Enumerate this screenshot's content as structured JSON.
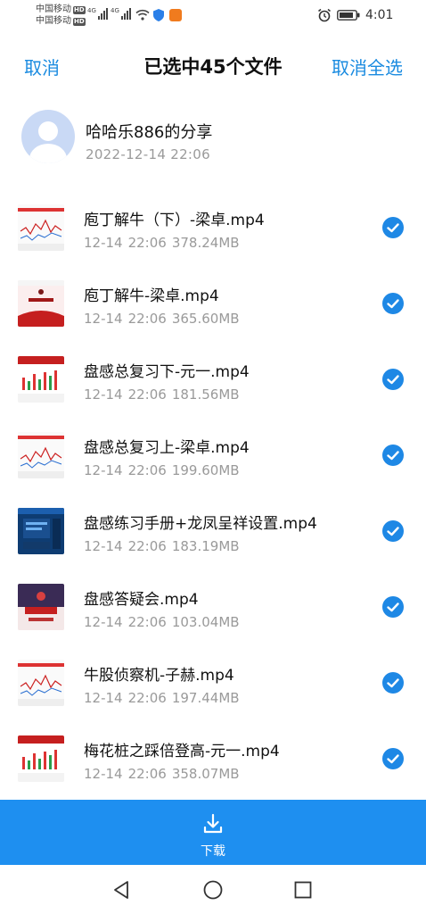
{
  "status_bar": {
    "carrier1": "中国移动",
    "carrier2": "中国移动",
    "hd_badge": "HD",
    "network": "4G",
    "time": "4:01"
  },
  "header": {
    "cancel_label": "取消",
    "title": "已选中45个文件",
    "deselect_all_label": "取消全选"
  },
  "share": {
    "owner_name": "哈哈乐886的分享",
    "date": "2022-12-14  22:06"
  },
  "files": [
    {
      "name": "庖丁解牛（下）-梁卓.mp4",
      "date": "12-14",
      "time": "22:06",
      "size": "378.24MB",
      "thumb_icon": "video-thumbnail-chart-icon"
    },
    {
      "name": "庖丁解牛-梁卓.mp4",
      "date": "12-14",
      "time": "22:06",
      "size": "365.60MB",
      "thumb_icon": "video-thumbnail-slide-icon"
    },
    {
      "name": "盘感总复习下-元一.mp4",
      "date": "12-14",
      "time": "22:06",
      "size": "181.56MB",
      "thumb_icon": "video-thumbnail-candles-icon"
    },
    {
      "name": "盘感总复习上-梁卓.mp4",
      "date": "12-14",
      "time": "22:06",
      "size": "199.60MB",
      "thumb_icon": "video-thumbnail-chart-icon"
    },
    {
      "name": "盘感练习手册+龙凤呈祥设置.mp4",
      "date": "12-14",
      "time": "22:06",
      "size": "183.19MB",
      "thumb_icon": "video-thumbnail-software-icon"
    },
    {
      "name": "盘感答疑会.mp4",
      "date": "12-14",
      "time": "22:06",
      "size": "103.04MB",
      "thumb_icon": "video-thumbnail-banner-icon"
    },
    {
      "name": "牛股侦察机-子赫.mp4",
      "date": "12-14",
      "time": "22:06",
      "size": "197.44MB",
      "thumb_icon": "video-thumbnail-chart-icon"
    },
    {
      "name": "梅花桩之踩倍登高-元一.mp4",
      "date": "12-14",
      "time": "22:06",
      "size": "358.07MB",
      "thumb_icon": "video-thumbnail-candles-icon"
    }
  ],
  "bottom_bar": {
    "download_label": "下载"
  },
  "colors": {
    "accent": "#1a8be0",
    "download_bar": "#1e8ff0",
    "check": "#1e88e5"
  }
}
